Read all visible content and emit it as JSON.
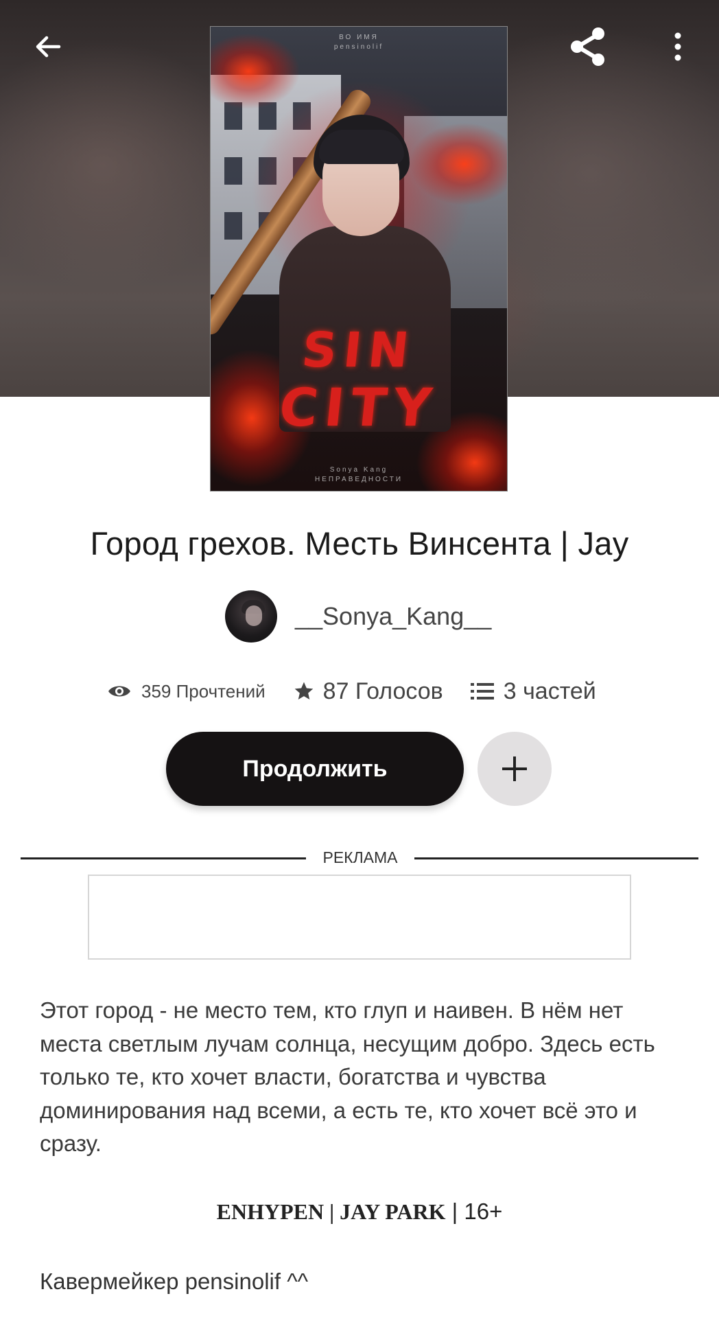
{
  "header": {
    "back_icon": "arrow-left-icon",
    "share_icon": "share-icon",
    "more_icon": "more-vertical-icon"
  },
  "cover": {
    "title_line1": "SIN",
    "title_line2": "CITY",
    "top_small_1": "ВО ИМЯ",
    "top_small_2": "pensinolif",
    "bottom_small_1": "Sonya Kang",
    "bottom_small_2": "НЕПРАВЕДНОСТИ"
  },
  "story": {
    "title": "Город грехов. Месть Винсента | Jay"
  },
  "author": {
    "name": "__Sonya_Kang__"
  },
  "stats": {
    "reads": "359 Прочтений",
    "votes": "87 Голосов",
    "parts": "3 частей"
  },
  "actions": {
    "continue_label": "Продолжить",
    "add_icon": "plus-icon"
  },
  "ad": {
    "label": "РЕКЛАМА"
  },
  "description": {
    "text": "Этот город - не место тем, кто глуп и наивен. В нём нет места светлым лучам солнца, несущим добро. Здесь есть только те, кто хочет власти, богатства и чувства доминирования над всеми, а есть те, кто хочет всё это и сразу.",
    "tag_bold": "ENHYPEN | JAY PARK",
    "tag_rest": " | 16+",
    "credit": "Кавермейкер pensinolif ^^"
  },
  "colors": {
    "primary_button": "#151213",
    "secondary_button": "#e2e0e1",
    "cover_accent": "#d8201c"
  }
}
